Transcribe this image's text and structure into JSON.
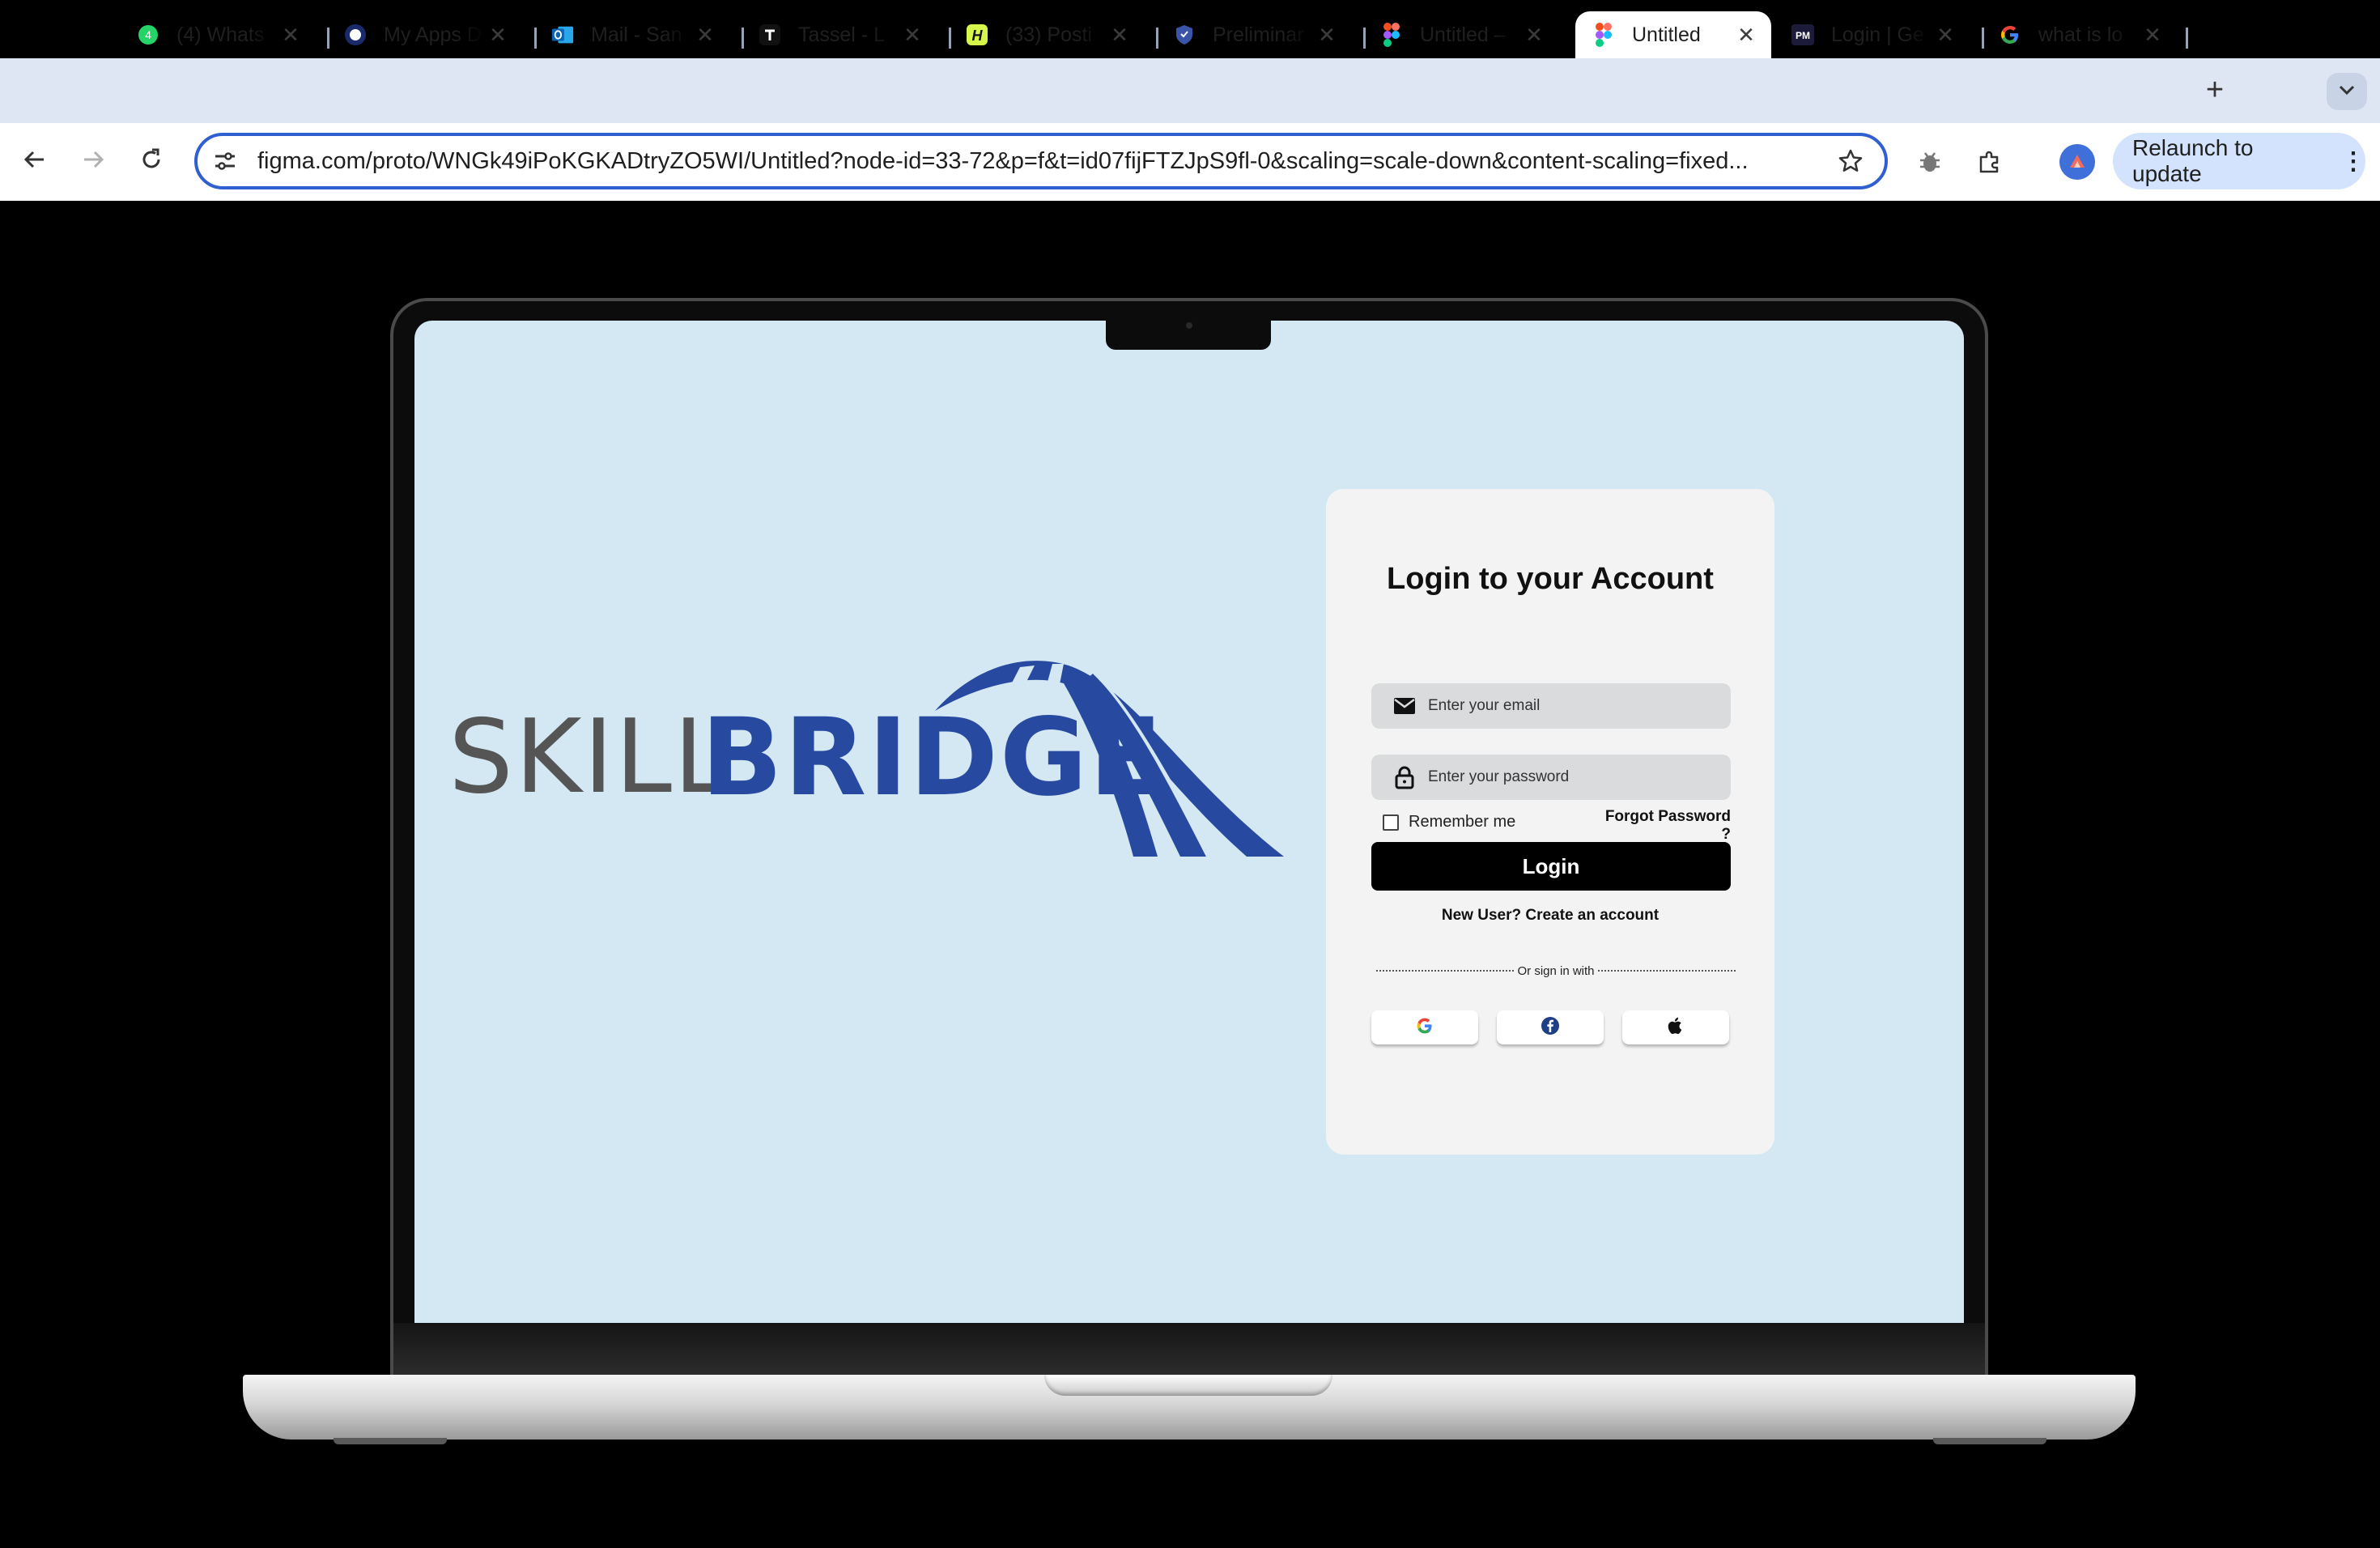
{
  "browser": {
    "tabs": [
      {
        "title": "(4) Whats",
        "favicon": "whatsapp-icon",
        "active": false
      },
      {
        "title": "My Apps D",
        "favicon": "okta-icon",
        "active": false
      },
      {
        "title": "Mail - San",
        "favicon": "outlook-icon",
        "active": false
      },
      {
        "title": "Tassel - L",
        "favicon": "tassel-icon",
        "active": false
      },
      {
        "title": "(33) Posti",
        "favicon": "handshake-icon",
        "active": false
      },
      {
        "title": "Preliminar",
        "favicon": "shield-icon",
        "active": false
      },
      {
        "title": "Untitled –",
        "favicon": "figma-icon",
        "active": false
      },
      {
        "title": "Untitled",
        "favicon": "figma-icon",
        "active": true
      },
      {
        "title": "Login | Ge",
        "favicon": "pm-icon",
        "active": false
      },
      {
        "title": "what is lo",
        "favicon": "google-icon",
        "active": false
      }
    ],
    "new_tab_label": "+",
    "close_glyph": "✕",
    "url": "figma.com/proto/WNGk49iPoKGKADtryZO5WI/Untitled?node-id=33-72&p=f&t=id07fijFTZJpS9fl-0&scaling=scale-down&content-scaling=fixed...",
    "relaunch_label": "Relaunch to update",
    "colors": {
      "tabstrip": "#dfe6f3",
      "omnibox_border": "#2f5fd0",
      "relaunch_bg": "#d3e3fd"
    }
  },
  "app": {
    "logo": {
      "part1": "SKILL",
      "part2": "BRIDGE",
      "color": "#2749a0"
    },
    "login": {
      "title": "Login to your Account",
      "email_placeholder": "Enter your email",
      "password_placeholder": "Enter your password",
      "remember_label": "Remember me",
      "forgot_label": "Forgot Password ?",
      "login_button": "Login",
      "signup_link": "New User? Create an account",
      "divider_text": "Or sign in with",
      "social": [
        "google-icon",
        "facebook-icon",
        "apple-icon"
      ]
    },
    "colors": {
      "screen_bg": "#d4e8f3",
      "card_bg": "#f3f3f3",
      "button_bg": "#000000"
    }
  }
}
